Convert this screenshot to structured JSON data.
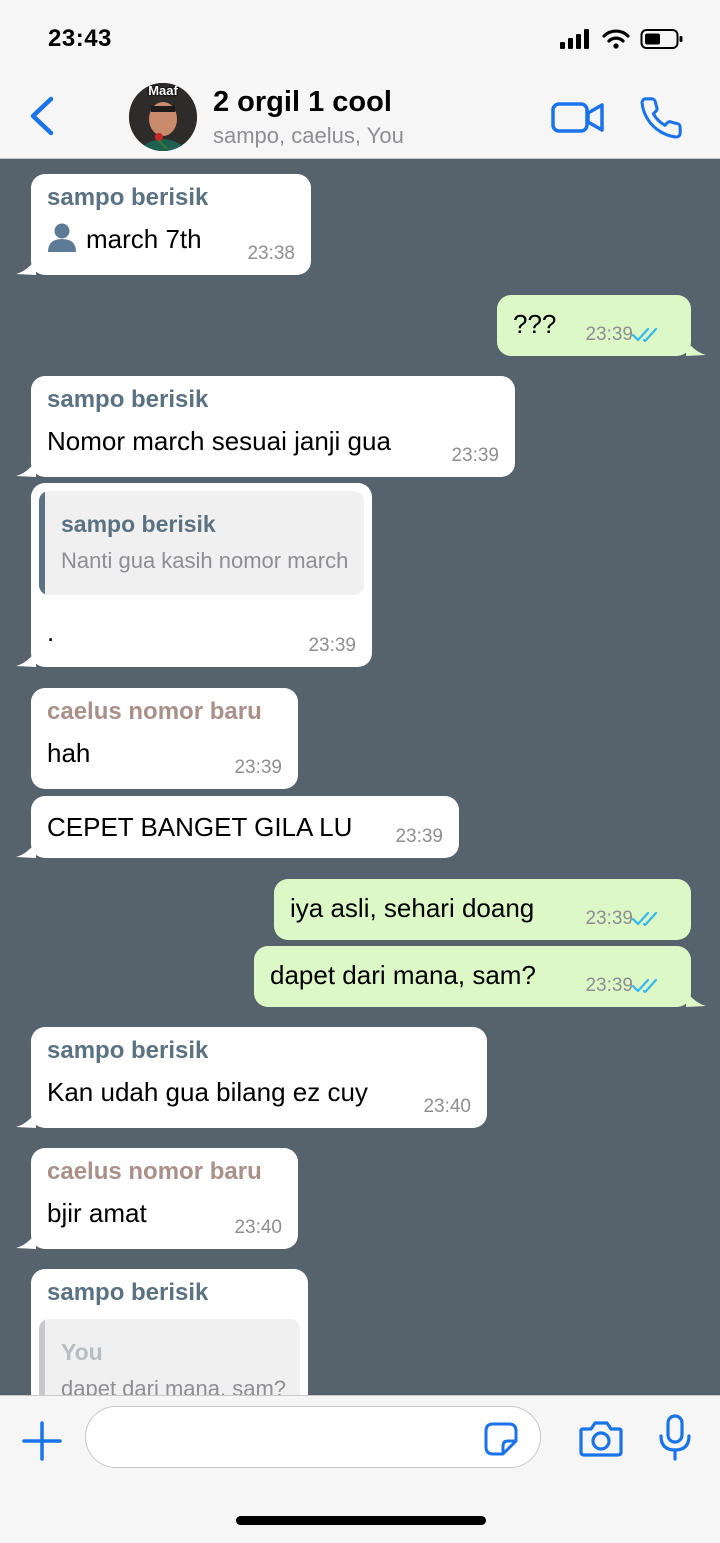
{
  "status_bar": {
    "time": "23:43"
  },
  "header": {
    "title": "2 orgil 1 cool",
    "subtitle": "sampo, caelus, You",
    "avatar_caption": "Maaf",
    "accent_color": "#1a73e8"
  },
  "messages": [
    {
      "direction": "incoming",
      "sender": "sampo berisik",
      "icon": "contact-person-icon",
      "text": "march 7th",
      "time": "23:38"
    },
    {
      "direction": "outgoing",
      "text": "???",
      "time": "23:39",
      "status": "read"
    },
    {
      "direction": "incoming",
      "sender": "sampo berisik",
      "text": "Nomor march sesuai janji gua",
      "time": "23:39"
    },
    {
      "direction": "incoming",
      "quote": {
        "sender": "sampo berisik",
        "text": "Nanti gua kasih nomor march"
      },
      "text": ".",
      "time": "23:39"
    },
    {
      "direction": "incoming",
      "sender": "caelus nomor baru",
      "text": "hah",
      "time": "23:39"
    },
    {
      "direction": "incoming",
      "text": "CEPET BANGET GILA LU",
      "time": "23:39"
    },
    {
      "direction": "outgoing",
      "text": "iya asli, sehari doang",
      "time": "23:39",
      "status": "read"
    },
    {
      "direction": "outgoing",
      "text": "dapet dari mana, sam?",
      "time": "23:39",
      "status": "read"
    },
    {
      "direction": "incoming",
      "sender": "sampo berisik",
      "text": "Kan udah gua bilang ez cuy",
      "time": "23:40"
    },
    {
      "direction": "incoming",
      "sender": "caelus nomor baru",
      "text": "bjir amat",
      "time": "23:40"
    },
    {
      "direction": "incoming",
      "sender": "sampo berisik",
      "quote": {
        "sender": "You",
        "text": "dapet dari mana, sam?"
      }
    }
  ],
  "colors": {
    "chat_background": "#57636c",
    "incoming_bubble": "#ffffff",
    "outgoing_bubble": "#dcf8c6",
    "sender_sampo": "#5b7282",
    "sender_caelus": "#a99088",
    "read_ticks": "#34b7f1"
  },
  "input": {
    "value": "",
    "placeholder": ""
  }
}
